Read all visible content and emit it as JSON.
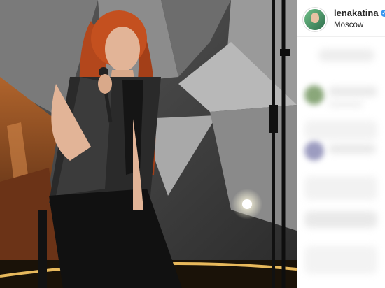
{
  "post": {
    "username": "lenakatina",
    "location": "Moscow",
    "verified_icon": "verified-badge-icon",
    "accent_color": "#3897f0"
  }
}
